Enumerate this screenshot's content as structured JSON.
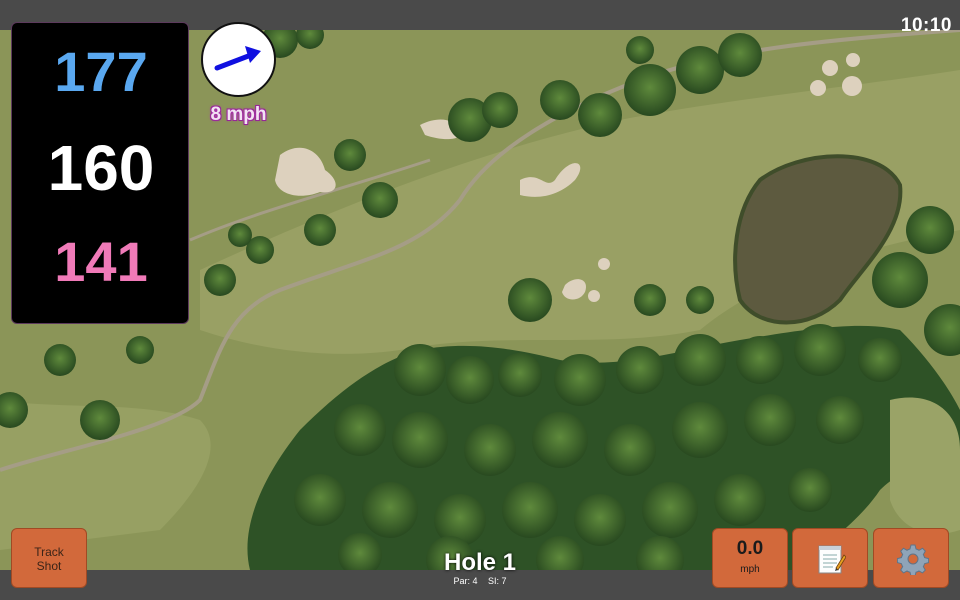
{
  "status": {
    "time": "10:10"
  },
  "distances": {
    "back": "177",
    "center": "160",
    "front": "141"
  },
  "wind": {
    "speed_label": "8 mph",
    "direction_icon": "arrow-icon"
  },
  "buttons": {
    "track_shot": {
      "line1": "Track",
      "line2": "Shot"
    },
    "wind": {
      "value": "0.0",
      "unit": "mph"
    },
    "notes_icon": "notepad-icon",
    "settings_icon": "gear-icon"
  },
  "hole": {
    "title": "Hole 1",
    "par": "Par: 4",
    "si": "SI: 7"
  },
  "colors": {
    "back": "#5aa8f0",
    "center": "#ffffff",
    "front": "#f07ab8",
    "button": "#d2693b"
  }
}
